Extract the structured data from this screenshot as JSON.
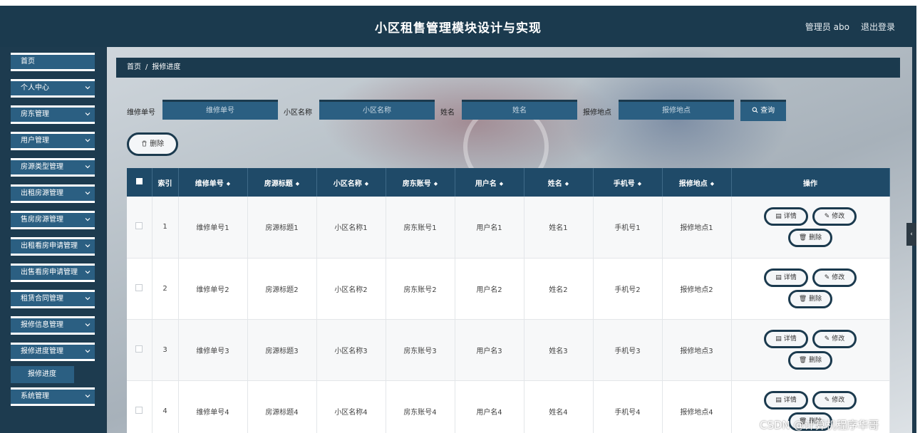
{
  "header": {
    "title": "小区租售管理模块设计与实现",
    "user": "管理员 abo",
    "logout": "退出登录"
  },
  "sidebar": {
    "items": [
      {
        "label": "首页",
        "has_arrow": false
      },
      {
        "label": "个人中心",
        "has_arrow": true
      },
      {
        "label": "房东管理",
        "has_arrow": true
      },
      {
        "label": "用户管理",
        "has_arrow": true
      },
      {
        "label": "房源类型管理",
        "has_arrow": true
      },
      {
        "label": "出租房源管理",
        "has_arrow": true
      },
      {
        "label": "售房房源管理",
        "has_arrow": true
      },
      {
        "label": "出租看房申请管理",
        "has_arrow": true
      },
      {
        "label": "出售看房申请管理",
        "has_arrow": true
      },
      {
        "label": "租赁合同管理",
        "has_arrow": true
      },
      {
        "label": "报修信息管理",
        "has_arrow": true
      },
      {
        "label": "报修进度管理",
        "has_arrow": true
      },
      {
        "label": "系统管理",
        "has_arrow": true
      }
    ],
    "submenu": {
      "label": "报修进度"
    }
  },
  "breadcrumb": {
    "home": "首页",
    "sep": "/",
    "current": "报修进度"
  },
  "search": {
    "fields": [
      {
        "label": "维修单号",
        "placeholder": "维修单号"
      },
      {
        "label": "小区名称",
        "placeholder": "小区名称"
      },
      {
        "label": "姓名",
        "placeholder": "姓名"
      },
      {
        "label": "报修地点",
        "placeholder": "报修地点"
      }
    ],
    "query_label": "查询",
    "delete_label": "删除"
  },
  "table": {
    "columns": [
      "索引",
      "维修单号",
      "房源标题",
      "小区名称",
      "房东账号",
      "用户名",
      "姓名",
      "手机号",
      "报修地点",
      "操作"
    ],
    "rows": [
      {
        "index": "1",
        "order": "维修单号1",
        "title": "房源标题1",
        "community": "小区名称1",
        "landlord": "房东账号1",
        "username": "用户名1",
        "name": "姓名1",
        "phone": "手机号1",
        "location": "报修地点1"
      },
      {
        "index": "2",
        "order": "维修单号2",
        "title": "房源标题2",
        "community": "小区名称2",
        "landlord": "房东账号2",
        "username": "用户名2",
        "name": "姓名2",
        "phone": "手机号2",
        "location": "报修地点2"
      },
      {
        "index": "3",
        "order": "维修单号3",
        "title": "房源标题3",
        "community": "小区名称3",
        "landlord": "房东账号3",
        "username": "用户名3",
        "name": "姓名3",
        "phone": "手机号3",
        "location": "报修地点3"
      },
      {
        "index": "4",
        "order": "维修单号4",
        "title": "房源标题4",
        "community": "小区名称4",
        "landlord": "房东账号4",
        "username": "用户名4",
        "name": "姓名4",
        "phone": "手机号4",
        "location": "报修地点4"
      }
    ],
    "actions": {
      "detail": "详情",
      "edit": "修改",
      "delete": "删除"
    }
  },
  "watermark": "CSDN @计算机程序华哥",
  "colors": {
    "header_bg": "#1b3a4e",
    "menu_bg": "#2b5f82",
    "table_header_bg": "#1f4a68"
  }
}
